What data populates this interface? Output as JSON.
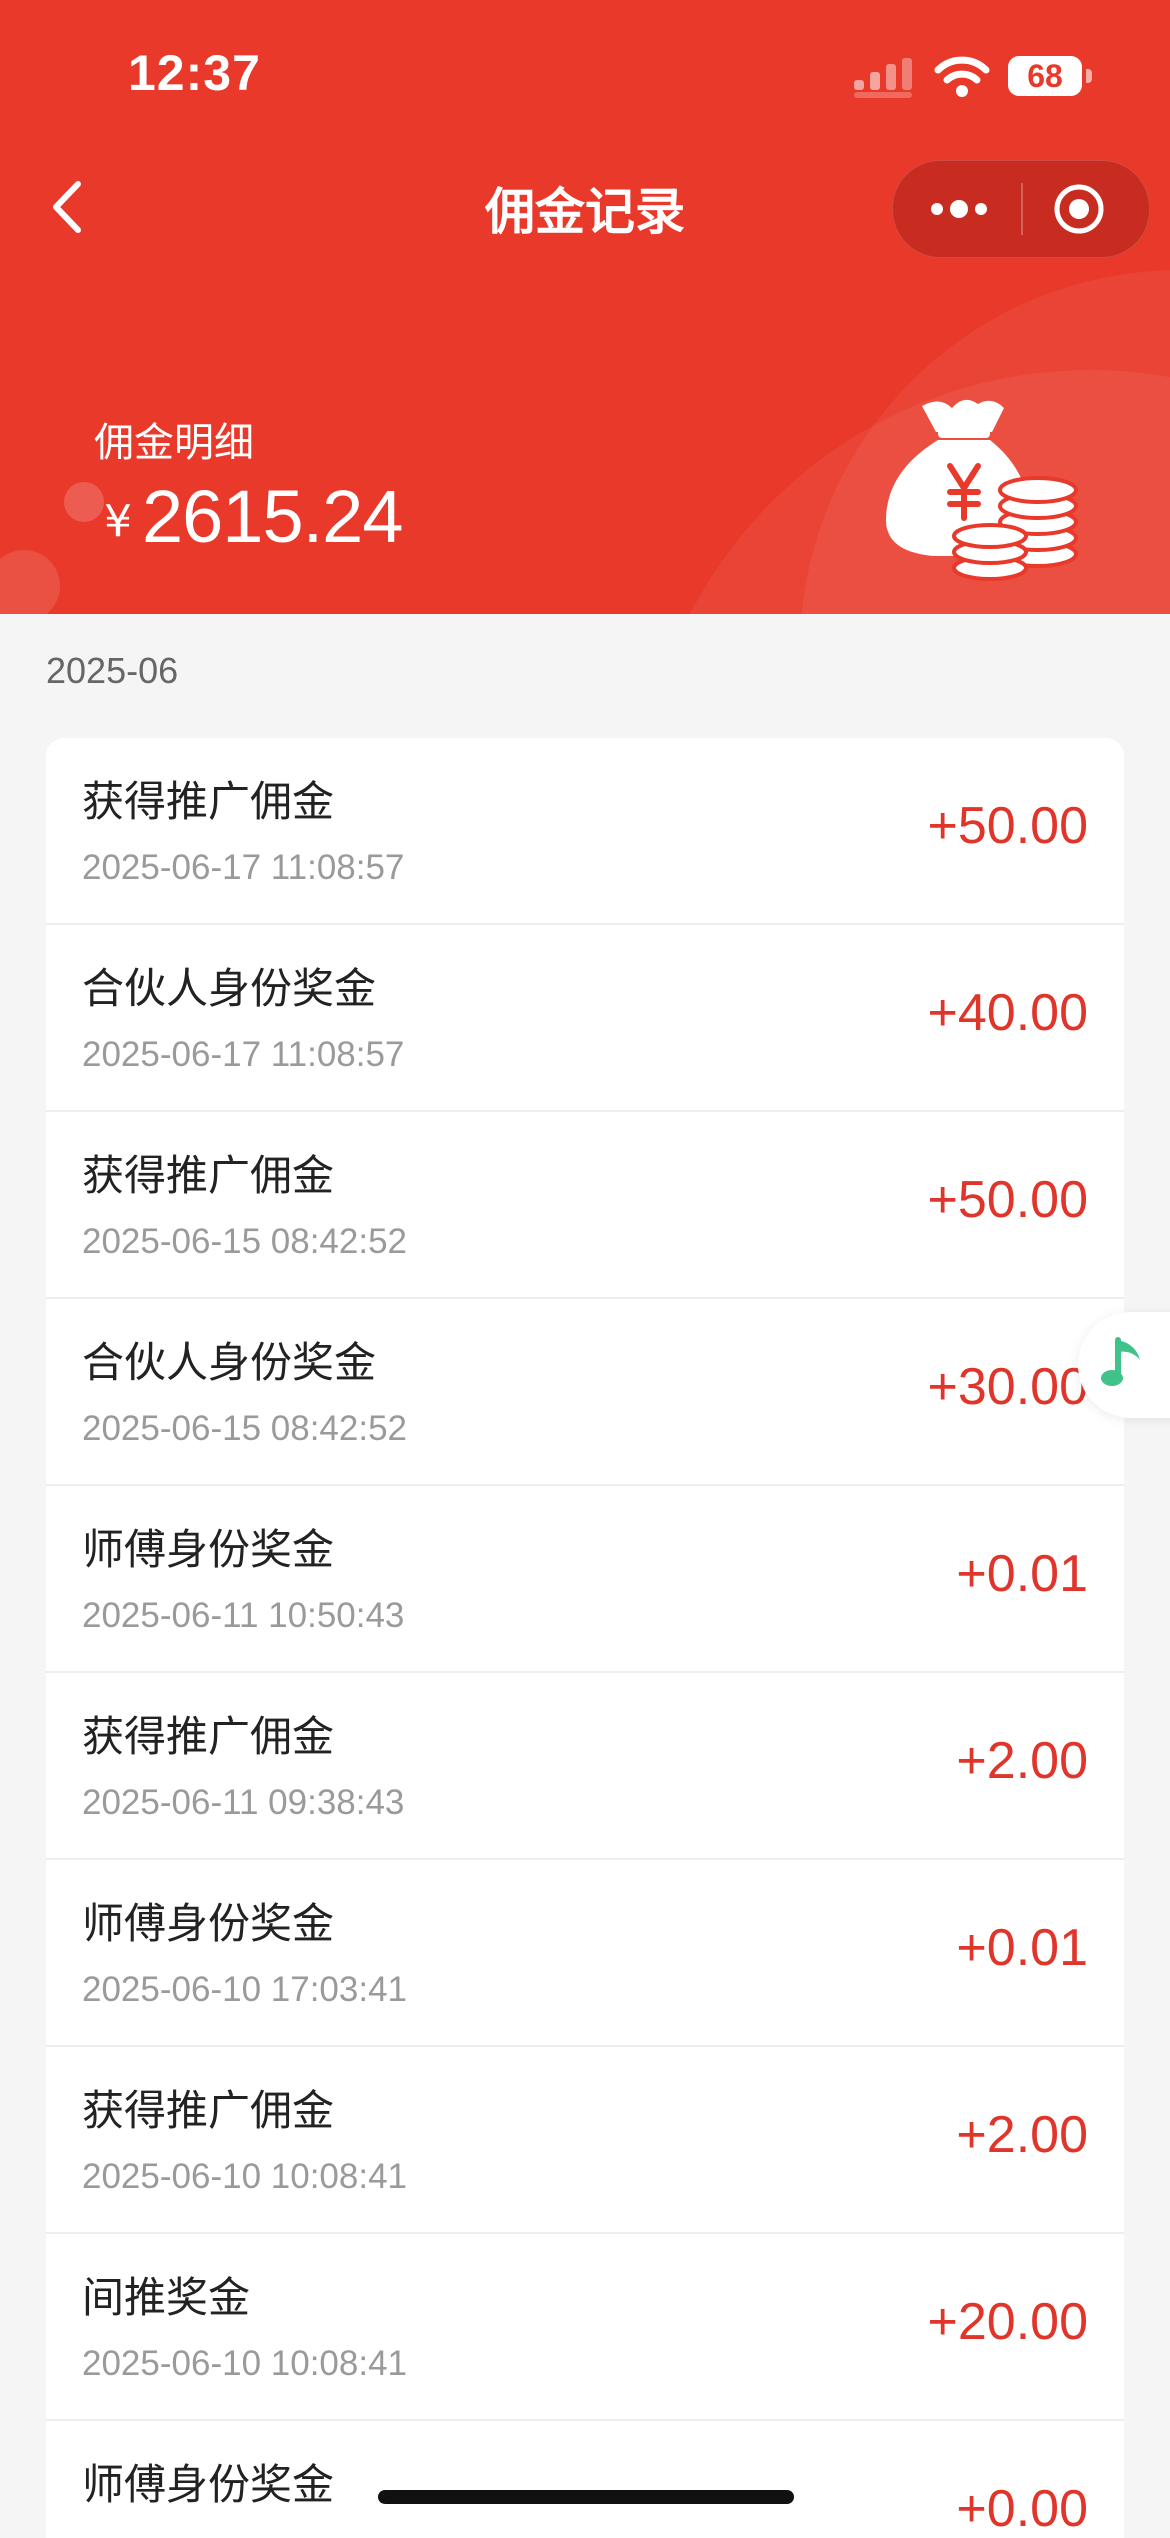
{
  "status_bar": {
    "time": "12:37",
    "battery": "68"
  },
  "nav": {
    "title": "佣金记录"
  },
  "summary": {
    "label": "佣金明细",
    "currency": "¥",
    "amount": "2615.24"
  },
  "month": "2025-06",
  "records": [
    {
      "title": "获得推广佣金",
      "date": "2025-06-17 11:08:57",
      "amount": "+50.00"
    },
    {
      "title": "合伙人身份奖金",
      "date": "2025-06-17 11:08:57",
      "amount": "+40.00"
    },
    {
      "title": "获得推广佣金",
      "date": "2025-06-15 08:42:52",
      "amount": "+50.00"
    },
    {
      "title": "合伙人身份奖金",
      "date": "2025-06-15 08:42:52",
      "amount": "+30.00"
    },
    {
      "title": "师傅身份奖金",
      "date": "2025-06-11 10:50:43",
      "amount": "+0.01"
    },
    {
      "title": "获得推广佣金",
      "date": "2025-06-11 09:38:43",
      "amount": "+2.00"
    },
    {
      "title": "师傅身份奖金",
      "date": "2025-06-10 17:03:41",
      "amount": "+0.01"
    },
    {
      "title": "获得推广佣金",
      "date": "2025-06-10 10:08:41",
      "amount": "+2.00"
    },
    {
      "title": "间推奖金",
      "date": "2025-06-10 10:08:41",
      "amount": "+20.00"
    },
    {
      "title": "师傅身份奖金",
      "date": "",
      "amount": "+0.00"
    }
  ],
  "colors": {
    "header": "#e8392a",
    "amount": "#e0352b",
    "music_icon": "#3fc38a"
  },
  "icons": {
    "back": "chevron-left-icon",
    "more": "more-dots-icon",
    "close": "target-circle-icon",
    "money": "money-bag-icon",
    "music": "music-note-icon"
  }
}
